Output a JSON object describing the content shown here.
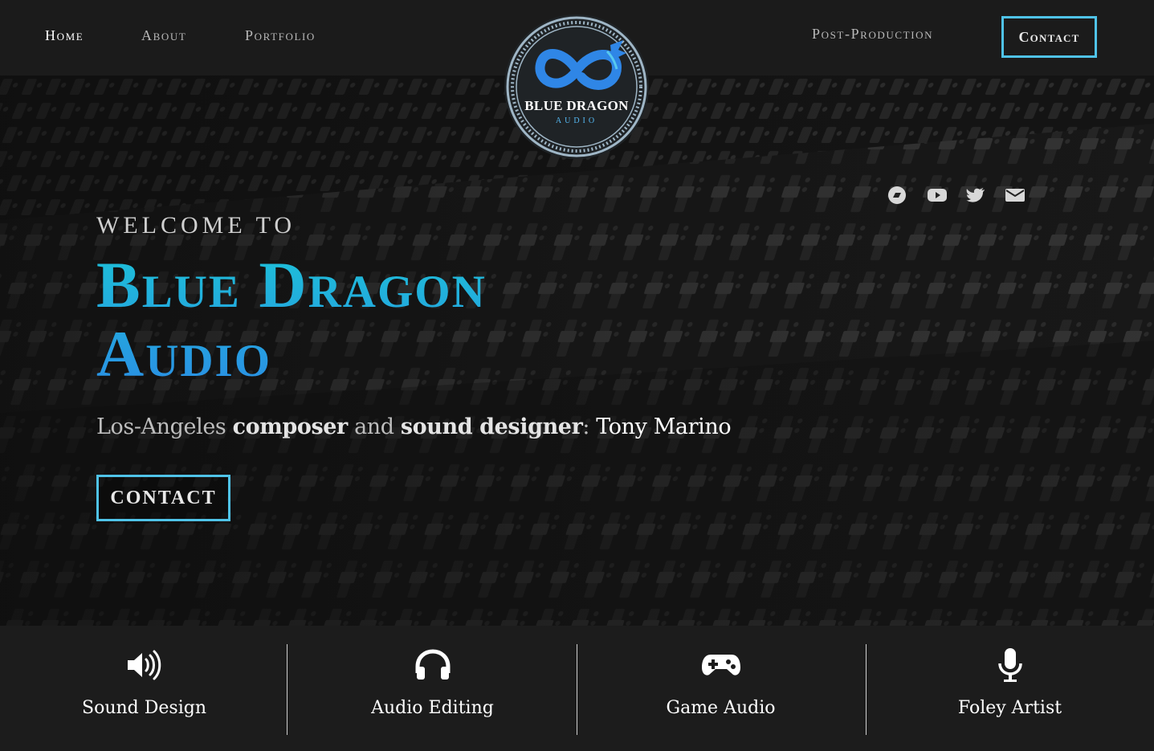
{
  "nav": {
    "home": "Home",
    "about": "About",
    "portfolio": "Portfolio",
    "post_production": "Post-Production",
    "contact": "Contact"
  },
  "logo": {
    "name": "BLUE DRAGON",
    "sub": "AUDIO"
  },
  "hero": {
    "welcome": "WELCOME TO",
    "title_line1": "Blue Dragon",
    "title_line2": "Audio",
    "tagline": {
      "part1": "Los-Angeles ",
      "bold1": "composer",
      "part2": " and ",
      "bold2": "sound designer",
      "part3": ": ",
      "name": "Tony Marino"
    },
    "cta": "CONTACT"
  },
  "social": [
    "soundcloud-icon",
    "youtube-icon",
    "twitter-icon",
    "envelope-icon"
  ],
  "services": [
    {
      "label": "Sound Design",
      "icon": "speaker-volume-icon"
    },
    {
      "label": "Audio Editing",
      "icon": "headphones-icon"
    },
    {
      "label": "Game Audio",
      "icon": "gamepad-icon"
    },
    {
      "label": "Foley Artist",
      "icon": "microphone-icon"
    }
  ],
  "colors": {
    "accent": "#4fc3e8",
    "title_top": "#1dc0d8",
    "title_bottom": "#2a8fe4",
    "background": "#1c1c1c"
  }
}
